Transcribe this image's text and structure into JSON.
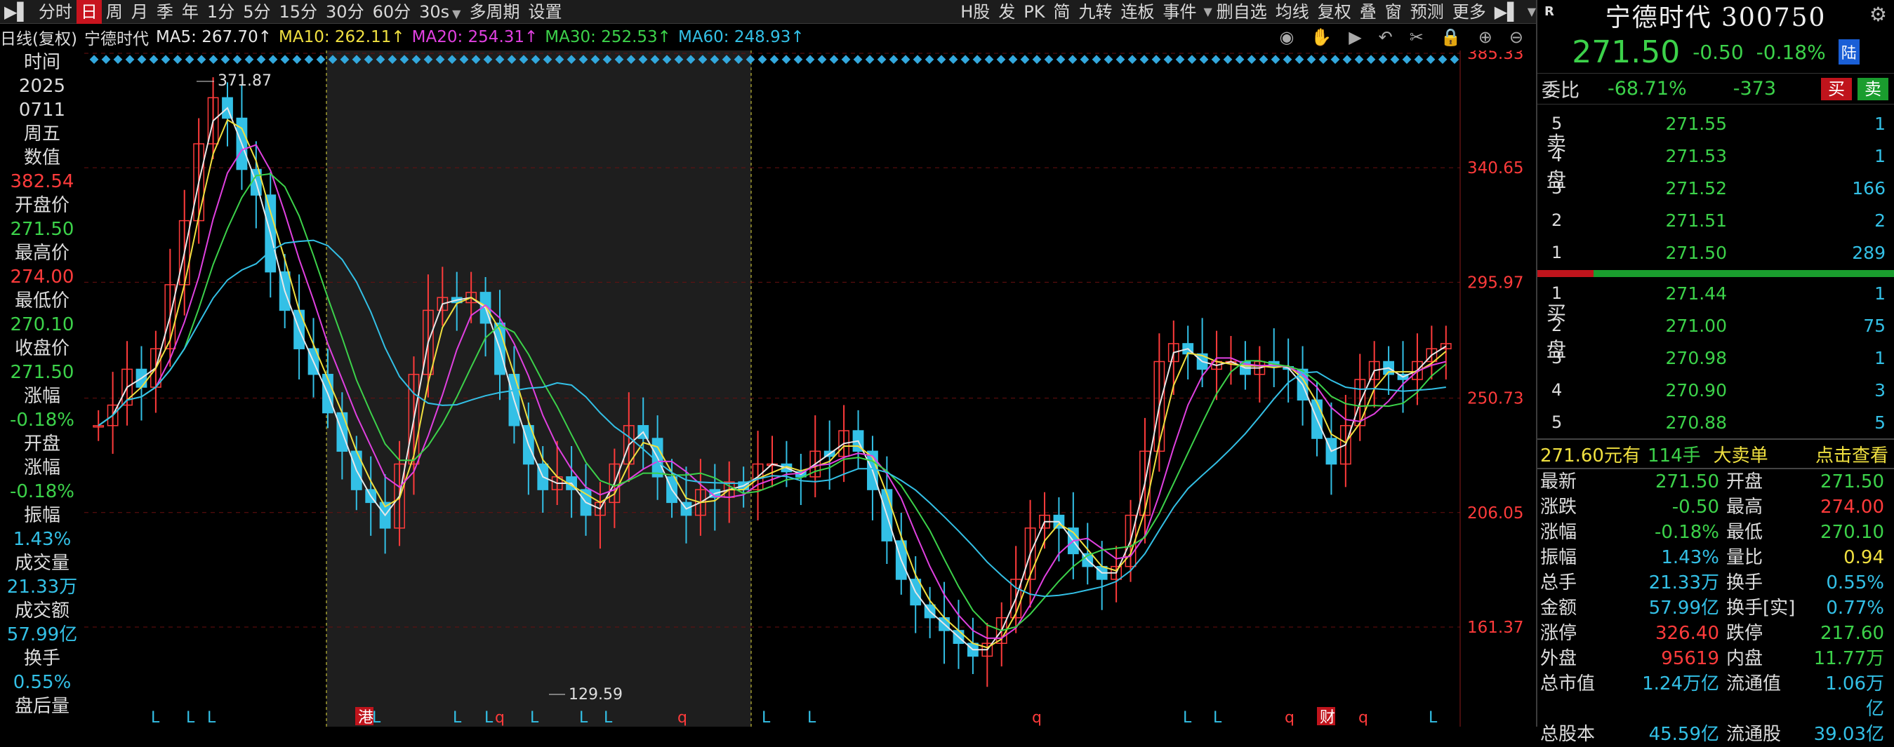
{
  "toolbar": {
    "items": [
      "分时",
      "日",
      "周",
      "月",
      "季",
      "年",
      "1分",
      "5分",
      "15分",
      "30分",
      "60分",
      "30s",
      "多周期",
      "设置",
      "H股",
      "发",
      "PK",
      "简",
      "九转",
      "连板",
      "事件",
      "删自选",
      "均线",
      "复权",
      "叠",
      "窗",
      "预测",
      "更多"
    ],
    "active": "日"
  },
  "infobar": {
    "period": "日线(复权)",
    "name": "宁德时代",
    "ma5": "MA5: 267.70↑",
    "ma10": "MA10: 262.11↑",
    "ma20": "MA20: 254.31↑",
    "ma30": "MA30: 252.53↑",
    "ma60": "MA60: 248.93↑"
  },
  "colors": {
    "up": "#ff3b3b",
    "down": "#3cd24a",
    "cyan": "#33c0e6",
    "ma5": "#e8e8e8",
    "ma10": "#f0e040",
    "ma20": "#e040e0",
    "ma30": "#3cd24a",
    "ma60": "#33c0e6"
  },
  "left": [
    "时间",
    "2025",
    "0711",
    "周五",
    "数值",
    "382.54",
    "开盘价",
    "271.50",
    "最高价",
    "274.00",
    "最低价",
    "270.10",
    "收盘价",
    "271.50",
    "涨幅",
    "-0.18%",
    "开盘",
    "涨幅",
    "-0.18%",
    "振幅",
    "1.43%",
    "成交量",
    "21.33万",
    "成交额",
    "57.99亿",
    "换手",
    "0.55%",
    "盘后量"
  ],
  "right": {
    "title": "宁德时代 300750",
    "r": "R",
    "price": "271.50",
    "change": "-0.50",
    "pct": "-0.18%",
    "lu": "陆",
    "weibi_label": "委比",
    "weibi": "-68.71%",
    "weicha": "-373",
    "buy": "买",
    "sell": "卖",
    "sell_label": "卖盘",
    "buy_label": "买盘",
    "asks": [
      {
        "lvl": "5",
        "p": "271.55",
        "v": "1"
      },
      {
        "lvl": "4",
        "p": "271.53",
        "v": "1"
      },
      {
        "lvl": "3",
        "p": "271.52",
        "v": "166"
      },
      {
        "lvl": "2",
        "p": "271.51",
        "v": "2"
      },
      {
        "lvl": "1",
        "p": "271.50",
        "v": "289"
      }
    ],
    "bids": [
      {
        "lvl": "1",
        "p": "271.44",
        "v": "1"
      },
      {
        "lvl": "2",
        "p": "271.00",
        "v": "75"
      },
      {
        "lvl": "3",
        "p": "270.98",
        "v": "1"
      },
      {
        "lvl": "4",
        "p": "270.90",
        "v": "3"
      },
      {
        "lvl": "5",
        "p": "270.88",
        "v": "5"
      }
    ],
    "big": {
      "a": "271.60元有",
      "b": "114手",
      "c": "大卖单",
      "d": "点击查看"
    },
    "stats": [
      [
        "最新",
        "271.50",
        "开盘",
        "271.50"
      ],
      [
        "涨跌",
        "-0.50",
        "最高",
        "274.00"
      ],
      [
        "涨幅",
        "-0.18%",
        "最低",
        "270.10"
      ],
      [
        "振幅",
        "1.43%",
        "量比",
        "0.94"
      ],
      [
        "总手",
        "21.33万",
        "换手",
        "0.55%"
      ],
      [
        "金额",
        "57.99亿",
        "换手[实]",
        "0.77%"
      ],
      [
        "涨停",
        "326.40",
        "跌停",
        "217.60"
      ],
      [
        "外盘",
        "95619",
        "内盘",
        "11.77万"
      ],
      [
        "总市值",
        "1.24万亿",
        "流通值",
        "1.06万亿"
      ],
      [
        "总股本",
        "45.59亿",
        "流通股",
        "39.03亿"
      ]
    ]
  },
  "chart_data": {
    "type": "candlestick",
    "y_ticks": [
      "385.33",
      "340.65",
      "295.97",
      "250.73",
      "206.05",
      "161.37"
    ],
    "y_range": [
      140,
      385.33
    ],
    "high_label": "371.87",
    "low_label": "129.59",
    "markers": [
      "L",
      "L",
      "L",
      "港",
      "L",
      "L",
      "L",
      "q",
      "L",
      "L",
      "L",
      "q",
      "L",
      "L",
      "q",
      "L",
      "L",
      "q",
      "财",
      "q",
      "L"
    ],
    "close": [
      240,
      248,
      262,
      255,
      270,
      295,
      320,
      350,
      368,
      360,
      340,
      330,
      300,
      285,
      270,
      260,
      245,
      230,
      215,
      210,
      200,
      225,
      260,
      285,
      290,
      288,
      292,
      280,
      260,
      240,
      225,
      215,
      220,
      215,
      205,
      210,
      225,
      240,
      235,
      220,
      210,
      205,
      215,
      212,
      218,
      215,
      225,
      225,
      222,
      220,
      230,
      228,
      238,
      230,
      215,
      195,
      180,
      170,
      165,
      160,
      155,
      150,
      155,
      165,
      180,
      200,
      205,
      200,
      190,
      185,
      180,
      185,
      205,
      230,
      265,
      272,
      268,
      262,
      265,
      265,
      260,
      265,
      263,
      262,
      250,
      235,
      225,
      240,
      258,
      265,
      260,
      258,
      265,
      270,
      272
    ]
  }
}
